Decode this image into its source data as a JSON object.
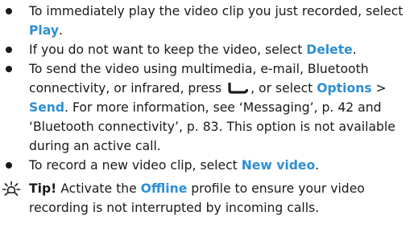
{
  "items": [
    {
      "pre": "To immediately play the video clip you just recorded, select ",
      "kw": "Play",
      "post": "."
    },
    {
      "pre": "If you do not want to keep the video, select ",
      "kw": "Delete",
      "post": "."
    },
    {
      "pre": "To send the video using multimedia, e-mail, Bluetooth connectivity, or infrared, press ",
      "softkey_icon": "call-key-icon",
      "mid1": ", or select ",
      "kw1": "Options",
      "mid2": " > ",
      "kw2": "Send",
      "post": ". For more information, see ‘Messaging’, p. 42 and ‘Bluetooth connectivity’, p. 83. This option is not available during an active call."
    },
    {
      "pre": "To record a new video clip, select ",
      "kw": "New video",
      "post": "."
    }
  ],
  "tip": {
    "icon": "tip-sun-icon",
    "label": "Tip!",
    "pre": " Activate the ",
    "kw": "Offline",
    "post": " profile to ensure your video recording is not interrupted by incoming calls."
  },
  "colors": {
    "keyword": "#2e8fd3",
    "text": "#1a1a1a"
  }
}
